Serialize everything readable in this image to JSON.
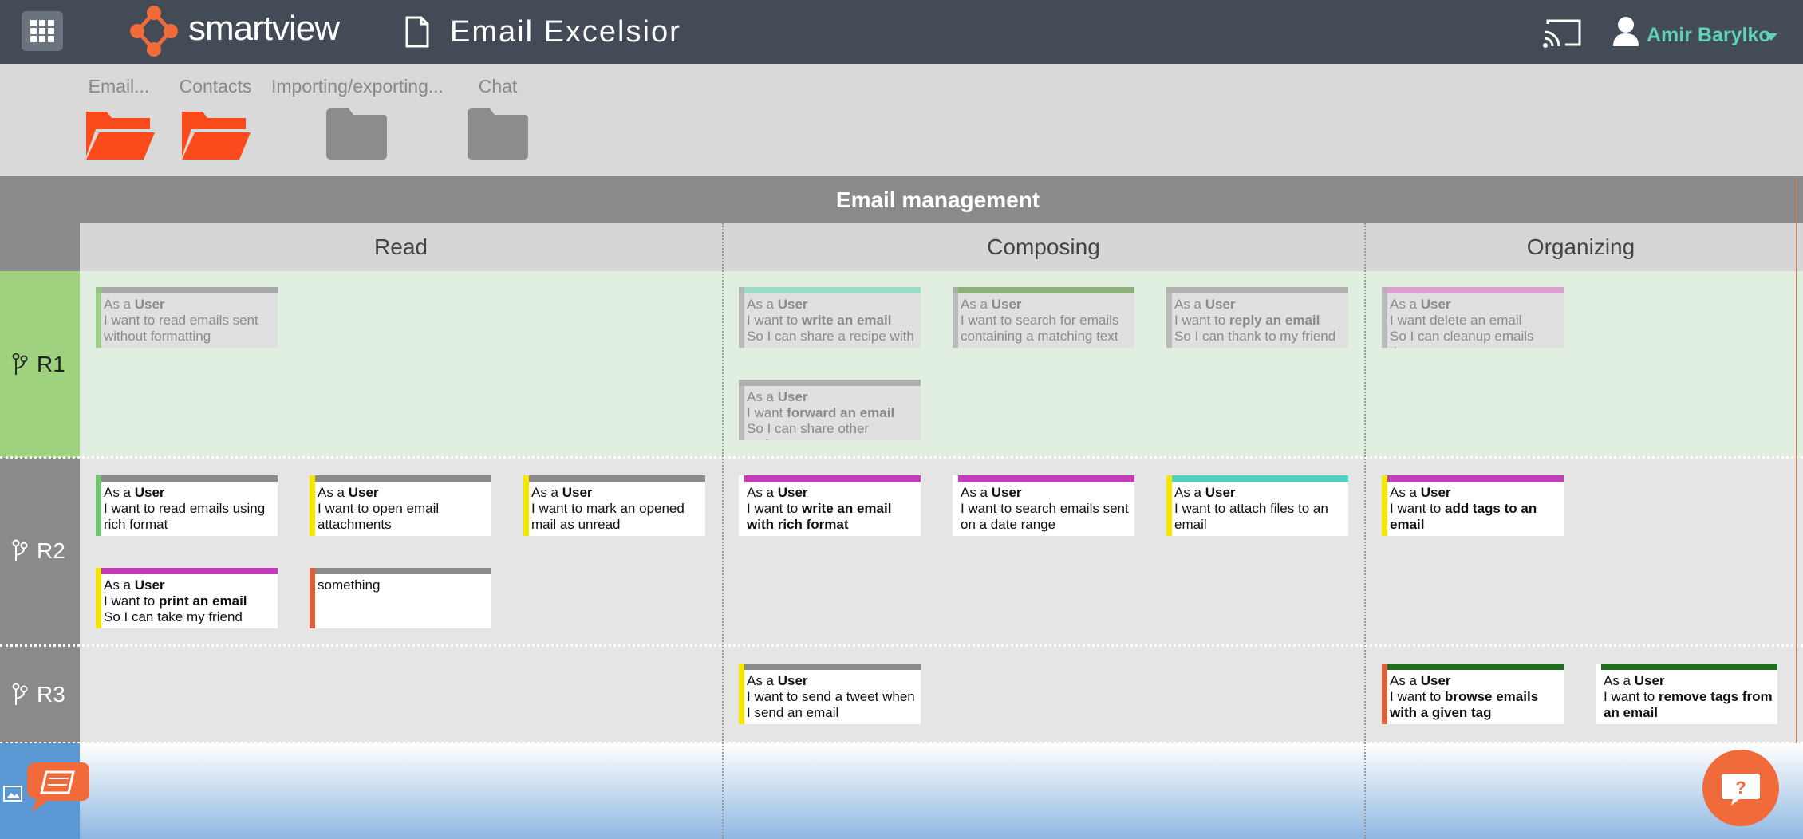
{
  "header": {
    "brand_text": "smartview",
    "project_title": "Email Excelsior",
    "user_name": "Amir Barylko"
  },
  "files": [
    {
      "label": "Email...",
      "state": "open"
    },
    {
      "label": "Contacts",
      "state": "open"
    },
    {
      "label": "Importing/exporting...",
      "state": "closed"
    },
    {
      "label": "Chat",
      "state": "closed"
    }
  ],
  "epic": {
    "title": "Email management"
  },
  "columns": [
    {
      "title": "Read"
    },
    {
      "title": "Composing"
    },
    {
      "title": "Organizing"
    }
  ],
  "releases": [
    {
      "label": "R1"
    },
    {
      "label": "R2"
    },
    {
      "label": "R3"
    }
  ],
  "colors": {
    "topbar": "#434b56",
    "accent_green": "#5ed1b8",
    "folder_open": "#fb4a1b",
    "folder_closed": "#8c8c8c",
    "release_r1": "#9ed27f",
    "release_other": "#8a8a8a",
    "help_button": "#f06a3a"
  },
  "cards": [
    {
      "id": "r1-read-1",
      "lines": [
        [
          "As a ",
          "User"
        ],
        [
          "I want to read emails sent",
          ""
        ],
        [
          "without formatting",
          ""
        ]
      ],
      "top": "#a9a9a9",
      "left": "#8ccb72",
      "faded": true
    },
    {
      "id": "r1-comp-1",
      "lines": [
        [
          "As a ",
          "User"
        ],
        [
          "I want to ",
          "write an email"
        ],
        [
          "So I can share a recipe with",
          ""
        ]
      ],
      "top": "#9adbc9",
      "left": "#b0b0b0",
      "faded": true
    },
    {
      "id": "r1-comp-2",
      "lines": [
        [
          "As a ",
          "User"
        ],
        [
          "I want to search for emails",
          ""
        ],
        [
          "containing a matching text",
          ""
        ]
      ],
      "top": "#8bb07a",
      "left": "#b0b0b0",
      "faded": true
    },
    {
      "id": "r1-comp-3",
      "lines": [
        [
          "As a ",
          "User"
        ],
        [
          "I want to ",
          "reply an email"
        ],
        [
          "So I can thank to my friend",
          ""
        ]
      ],
      "top": "#b0b0b0",
      "left": "#b0b0b0",
      "faded": true
    },
    {
      "id": "r1-comp-4",
      "lines": [
        [
          "As a ",
          "User"
        ],
        [
          "I want ",
          "forward an email"
        ],
        [
          "So I can share other recipes",
          ""
        ]
      ],
      "top": "#b0b0b0",
      "left": "#b0b0b0",
      "faded": true
    },
    {
      "id": "r1-org-1",
      "lines": [
        [
          "As a ",
          "User"
        ],
        [
          "I want delete an email",
          ""
        ],
        [
          "So I can cleanup emails that",
          ""
        ]
      ],
      "top": "#dd9fd0",
      "left": "#b0b0b0",
      "faded": true
    },
    {
      "id": "r2-read-1",
      "lines": [
        [
          "As a ",
          "User"
        ],
        [
          "I want to read emails using",
          ""
        ],
        [
          "rich format",
          ""
        ]
      ],
      "top": "#8a8a8a",
      "left": "#6dc76d",
      "faded": false
    },
    {
      "id": "r2-read-2",
      "lines": [
        [
          "As a ",
          "User"
        ],
        [
          "I want to open email",
          ""
        ],
        [
          "attachments",
          ""
        ]
      ],
      "top": "#8a8a8a",
      "left": "#f5e800",
      "faded": false
    },
    {
      "id": "r2-read-3",
      "lines": [
        [
          "As a ",
          "User"
        ],
        [
          "I want to mark an opened",
          ""
        ],
        [
          "mail as unread",
          ""
        ]
      ],
      "top": "#8a8a8a",
      "left": "#f5e800",
      "faded": false
    },
    {
      "id": "r2-read-4",
      "lines": [
        [
          "As a ",
          "User"
        ],
        [
          "I want to ",
          "print an email"
        ],
        [
          "So I can take my friend",
          ""
        ]
      ],
      "top": "#c23cb8",
      "left": "#f5e800",
      "faded": false
    },
    {
      "id": "r2-read-5",
      "lines": [
        [
          "something",
          ""
        ]
      ],
      "top": "#8a8a8a",
      "left": "#d9623a",
      "faded": false
    },
    {
      "id": "r2-comp-1",
      "lines": [
        [
          "As a ",
          "User"
        ],
        [
          "I want to ",
          "write an email"
        ],
        [
          "",
          "with rich format"
        ]
      ],
      "top": "#c23cb8",
      "left": "#ffffff",
      "faded": false
    },
    {
      "id": "r2-comp-2",
      "lines": [
        [
          "As a ",
          "User"
        ],
        [
          "I want to search emails sent",
          ""
        ],
        [
          "on a date range",
          ""
        ]
      ],
      "top": "#c23cb8",
      "left": "#ffffff",
      "faded": false
    },
    {
      "id": "r2-comp-3",
      "lines": [
        [
          "As a ",
          "User"
        ],
        [
          "I want to attach files to an",
          ""
        ],
        [
          "email",
          ""
        ]
      ],
      "top": "#4dcfc4",
      "left": "#f5e800",
      "faded": false
    },
    {
      "id": "r2-org-1",
      "lines": [
        [
          "As a ",
          "User"
        ],
        [
          "I want to ",
          "add tags to an"
        ],
        [
          "",
          "email"
        ]
      ],
      "top": "#c23cb8",
      "left": "#f5e800",
      "faded": false
    },
    {
      "id": "r3-comp-1",
      "lines": [
        [
          "As a ",
          "User"
        ],
        [
          "I want to send a tweet when",
          ""
        ],
        [
          "I send an email",
          ""
        ]
      ],
      "top": "#8a8a8a",
      "left": "#f5e800",
      "faded": false
    },
    {
      "id": "r3-org-1",
      "lines": [
        [
          "As a ",
          "User"
        ],
        [
          "I want to ",
          "browse emails"
        ],
        [
          "",
          "with a given tag"
        ]
      ],
      "top": "#1f6b1f",
      "left": "#d9623a",
      "faded": false
    },
    {
      "id": "r3-org-2",
      "lines": [
        [
          "As a ",
          "User"
        ],
        [
          "I want to ",
          "remove tags from"
        ],
        [
          "",
          "an email"
        ]
      ],
      "top": "#1f6b1f",
      "left": "#ffffff",
      "faded": false
    }
  ]
}
